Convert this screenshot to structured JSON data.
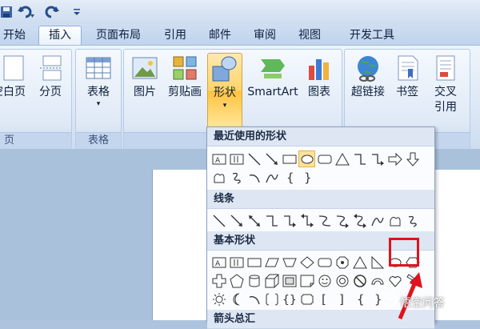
{
  "qat": {
    "icons": [
      "save-icon",
      "undo-icon",
      "redo-icon",
      "customize-icon"
    ]
  },
  "tabs": [
    {
      "label": "开始",
      "active": false
    },
    {
      "label": "插入",
      "active": true
    },
    {
      "label": "页面布局",
      "active": false
    },
    {
      "label": "引用",
      "active": false
    },
    {
      "label": "邮件",
      "active": false
    },
    {
      "label": "审阅",
      "active": false
    },
    {
      "label": "视图",
      "active": false
    },
    {
      "label": "开发工具",
      "active": false
    }
  ],
  "ribbon": {
    "groups": {
      "pages": {
        "label": "页",
        "blank_page": "空白页",
        "page_break": "分页"
      },
      "tables": {
        "label": "表格",
        "table": "表格"
      },
      "illustrations": {
        "picture": "图片",
        "clipart": "剪贴画",
        "shapes": "形状",
        "smartart": "SmartArt",
        "chart": "图表"
      },
      "links": {
        "hyperlink": "超链接",
        "bookmark": "书签",
        "crossref_1": "交叉",
        "crossref_2": "引用"
      }
    }
  },
  "shapes_menu": {
    "sections": {
      "recent": "最近使用的形状",
      "lines": "线条",
      "basic": "基本形状",
      "arrows": "箭头总汇"
    },
    "selected_shape": "oval"
  },
  "watermark": {
    "text": "悟空问答"
  },
  "colors": {
    "highlight": "#ffd36b",
    "annotation_red": "#e0121b",
    "ribbon_blue": "#dde8f6"
  }
}
